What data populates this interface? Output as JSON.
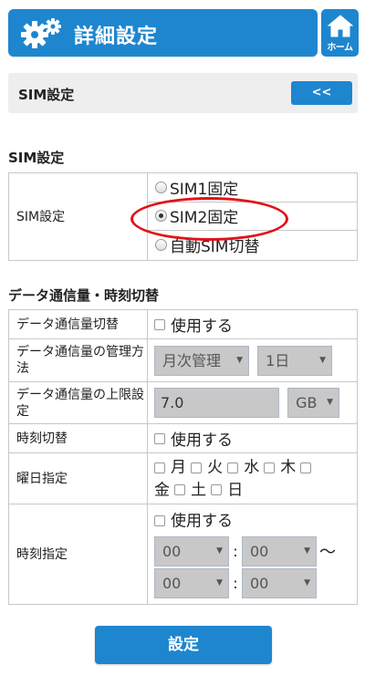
{
  "header": {
    "title": "詳細設定",
    "home_label": "ホーム"
  },
  "sim_bar": {
    "label": "SIM設定",
    "back_label": "<<"
  },
  "sim_section": {
    "title": "SIM設定",
    "row_label": "SIM設定",
    "options": [
      {
        "label": "SIM1固定",
        "selected": false
      },
      {
        "label": "SIM2固定",
        "selected": true
      },
      {
        "label": "自動SIM切替",
        "selected": false
      }
    ]
  },
  "data_section": {
    "title": "データ通信量・時刻切替",
    "rows": {
      "switch": {
        "label": "データ通信量切替",
        "checkbox": "使用する"
      },
      "method": {
        "label": "データ通信量の管理方法",
        "select1": "月次管理",
        "select2": "1日"
      },
      "limit": {
        "label": "データ通信量の上限設定",
        "value": "7.0",
        "unit": "GB"
      },
      "time_switch": {
        "label": "時刻切替",
        "checkbox": "使用する"
      },
      "weekday": {
        "label": "曜日指定",
        "days": [
          "月",
          "火",
          "水",
          "木",
          "金",
          "土",
          "日"
        ]
      },
      "time": {
        "label": "時刻指定",
        "checkbox": "使用する",
        "h1": "00",
        "m1": "00",
        "h2": "00",
        "m2": "00",
        "colon": ":",
        "tilde": "～"
      }
    }
  },
  "submit_label": "設定",
  "colors": {
    "accent": "#1e86cf",
    "highlight": "#e0121a"
  },
  "icons": {
    "header": "gear-icon",
    "home": "home-icon"
  }
}
